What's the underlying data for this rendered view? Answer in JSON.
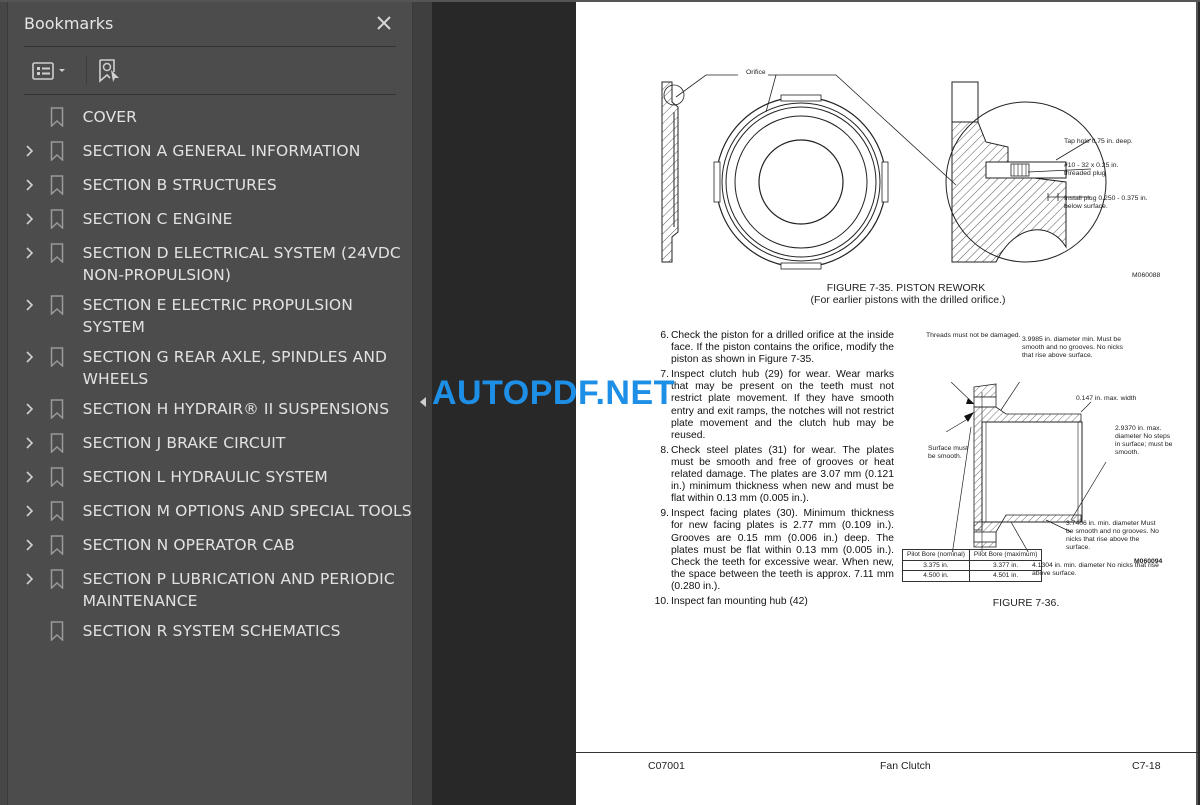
{
  "bookmarks_panel": {
    "title": "Bookmarks",
    "close_icon": "close-icon",
    "toolbar": {
      "options_icon": "list-options-icon",
      "find_bookmark_icon": "find-current-bookmark-icon"
    },
    "items": [
      {
        "label": "COVER",
        "expandable": false
      },
      {
        "label": "SECTION A GENERAL INFORMATION",
        "expandable": true
      },
      {
        "label": "SECTION B STRUCTURES",
        "expandable": true
      },
      {
        "label": "SECTION C ENGINE",
        "expandable": true
      },
      {
        "label": "SECTION D ELECTRICAL SYSTEM (24VDC NON-PROPULSION)",
        "expandable": true
      },
      {
        "label": "SECTION E ELECTRIC PROPULSION SYSTEM",
        "expandable": true
      },
      {
        "label": "SECTION G REAR AXLE, SPINDLES AND WHEELS",
        "expandable": true
      },
      {
        "label": "SECTION H HYDRAIR® II SUSPENSIONS",
        "expandable": true
      },
      {
        "label": "SECTION J BRAKE CIRCUIT",
        "expandable": true
      },
      {
        "label": "SECTION L HYDRAULIC SYSTEM",
        "expandable": true
      },
      {
        "label": "SECTION M OPTIONS AND SPECIAL TOOLS",
        "expandable": true
      },
      {
        "label": "SECTION N OPERATOR CAB",
        "expandable": true
      },
      {
        "label": "SECTION P LUBRICATION AND PERIODIC MAINTENANCE",
        "expandable": true
      },
      {
        "label": "SECTION R SYSTEM SCHEMATICS",
        "expandable": false
      }
    ]
  },
  "watermark": "AUTOPDF.NET",
  "page": {
    "figure_35": {
      "orifice_label": "Orifice",
      "tap_hole": "Tap hole 0.75 in. deep.",
      "plug_line1": "#10 - 32 x 0.25 in.",
      "plug_line2": "threaded plug",
      "install_line1": "Install plug 0.250 - 0.375 in.",
      "install_line2": "below surface.",
      "code": "M060088",
      "caption": "FIGURE 7-35. PISTON REWORK",
      "subcaption": "(For earlier pistons with the drilled orifice.)"
    },
    "steps": [
      {
        "num": "6.",
        "text": "Check the piston for a drilled orifice at the inside face. If the piston contains the orifice, modify the piston as shown in Figure 7-35."
      },
      {
        "num": "7.",
        "text": "Inspect clutch hub (29) for wear. Wear marks that may be present on the teeth must not restrict plate movement. If they have smooth entry and exit ramps, the notches will not restrict plate movement and the clutch hub may be reused."
      },
      {
        "num": "8.",
        "text": "Check steel plates (31) for wear. The plates must be smooth and free of grooves or heat related damage. The plates are 3.07 mm (0.121 in.) minimum thickness when new and must be flat within 0.13 mm (0.005 in.)."
      },
      {
        "num": "9.",
        "text": "Inspect facing plates (30). Minimum thickness for new facing plates is 2.77 mm (0.109 in.). Grooves are 0.15 mm (0.006 in.) deep. The plates must be flat within 0.13 mm (0.005 in.). Check the teeth for excessive wear. When new, the space between the teeth is approx. 7.11 mm (0.280 in.)."
      },
      {
        "num": "10.",
        "text": "Inspect fan mounting hub (42)"
      }
    ],
    "figure_36": {
      "threads": "Threads must not be damaged.",
      "diam_39985": "3.9985 in. diameter min. Must be smooth and no grooves. No nicks that rise above surface.",
      "width_0147": "0.147 in. max. width",
      "diam_29370": "2.9370 in. max. diameter No steps in surface; must be smooth.",
      "surface": "Surface must be smooth.",
      "diam_37406": "3.7406 in. min. diameter Must be smooth and no grooves. No nicks that rise above the surface.",
      "diam_41304": "4.1304 in. min. diameter No nicks that rise above surface.",
      "table": {
        "headers": [
          "Pilot Bore (nominal)",
          "Pilot Bore (maximum)"
        ],
        "rows": [
          [
            "3.375 in.",
            "3.377 in."
          ],
          [
            "4.500 in.",
            "4.501 in."
          ]
        ]
      },
      "code": "M060094",
      "caption": "FIGURE 7-36."
    },
    "footer": {
      "left": "C07001",
      "center": "Fan Clutch",
      "right": "C7-18"
    }
  }
}
